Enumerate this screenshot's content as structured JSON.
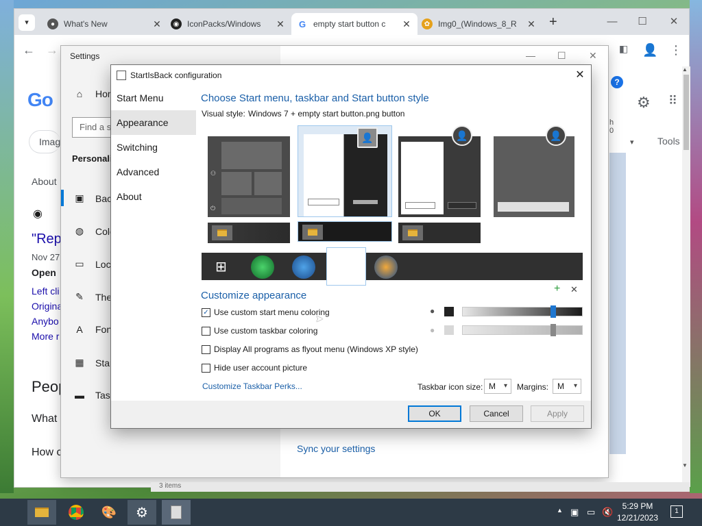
{
  "browser": {
    "tabs": [
      {
        "title": "What's New",
        "icon": "chrome-icon"
      },
      {
        "title": "IconPacks/Windows",
        "icon": "github-icon"
      },
      {
        "title": "empty start button c",
        "icon": "google-icon",
        "active": true
      },
      {
        "title": "Img0_(Windows_8_R",
        "icon": "flower-icon"
      }
    ],
    "page_peek": {
      "about": "About",
      "rep": "\"Rep",
      "date": "Nov 27",
      "open": "Open",
      "left_cli": "Left cli",
      "origina": "Origina",
      "anybo": "Anybo",
      "more": "More r",
      "people": "Peop",
      "what": "What",
      "how": "How c",
      "imag": "Imag",
      "tools": "Tools",
      "h": "h",
      "zero": "0"
    }
  },
  "settings": {
    "title": "Settings",
    "home": "Hom",
    "find_placeholder": "Find a s",
    "section": "Personali",
    "nav": [
      "Back",
      "Colo",
      "Lock",
      "Ther",
      "Font",
      "Start",
      "Task"
    ],
    "sync": "Sync your settings"
  },
  "dialog": {
    "title": "StartIsBack configuration",
    "nav": [
      "Start Menu",
      "Appearance",
      "Switching",
      "Advanced",
      "About"
    ],
    "selected_nav": "Appearance",
    "heading": "Choose Start menu, taskbar and Start button style",
    "visual_style_label": "Visual style:",
    "visual_style_value": "Windows 7 + empty start button.png button",
    "customize_heading": "Customize appearance",
    "options": [
      {
        "label": "Use custom start menu coloring",
        "checked": true
      },
      {
        "label": "Use custom taskbar coloring",
        "checked": false
      },
      {
        "label": "Display All programs as flyout menu (Windows XP style)",
        "checked": false
      },
      {
        "label": "Hide user account picture",
        "checked": false
      }
    ],
    "link": "Customize Taskbar Perks...",
    "icon_size_label": "Taskbar icon size:",
    "icon_size_value": "M",
    "margins_label": "Margins:",
    "margins_value": "M",
    "ok": "OK",
    "cancel": "Cancel",
    "apply": "Apply",
    "colors": {
      "accent": "#1a5fa8",
      "slider_thumb": "#1f77d0",
      "dark_swatch": "#222222",
      "light_swatch": "#d8d8d8"
    }
  },
  "taskbar": {
    "time": "5:29 PM",
    "date": "12/21/2023",
    "notifications": "1",
    "status_text": "3 items"
  }
}
